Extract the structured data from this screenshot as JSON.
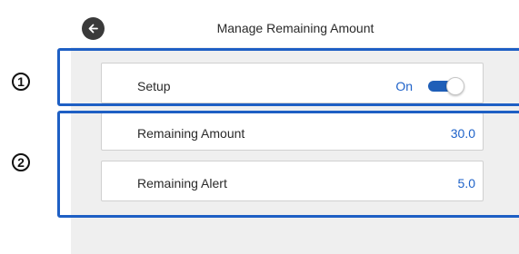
{
  "header": {
    "title": "Manage Remaining Amount",
    "back_icon": "arrow-left-icon"
  },
  "settings": {
    "setup": {
      "label": "Setup",
      "state": "On",
      "enabled": true
    },
    "remaining_amount": {
      "label": "Remaining Amount",
      "value": "30.0"
    },
    "remaining_alert": {
      "label": "Remaining Alert",
      "value": "5.0"
    }
  },
  "callouts": [
    {
      "number": "1"
    },
    {
      "number": "2"
    }
  ],
  "colors": {
    "accent": "#1e62c9",
    "callout_border": "#1e5fc4",
    "toggle_track": "#1f5fb8",
    "background": "#efefef"
  }
}
